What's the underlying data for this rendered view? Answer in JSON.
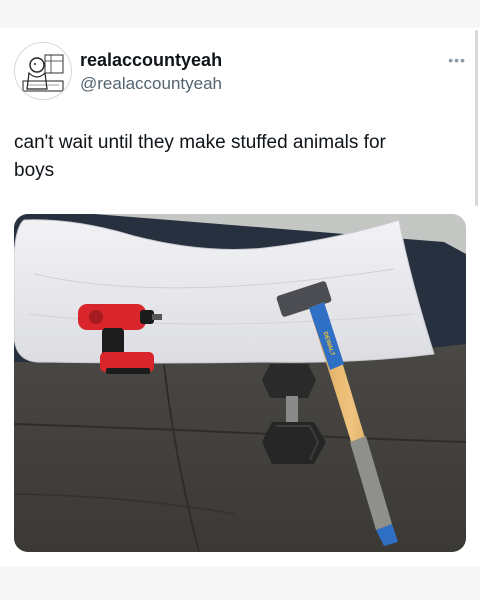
{
  "tweet": {
    "author": {
      "name": "realaccountyeah",
      "handle": "@realaccountyeah"
    },
    "more_label": "•••",
    "text": "can't wait until they make stuffed animals for\nboys"
  },
  "photo": {
    "hammer_brand": "DEWALT"
  },
  "colors": {
    "name": "#0f1419",
    "handle": "#536471",
    "page_bg": "#f7f7f7",
    "card_bg": "#ffffff"
  }
}
